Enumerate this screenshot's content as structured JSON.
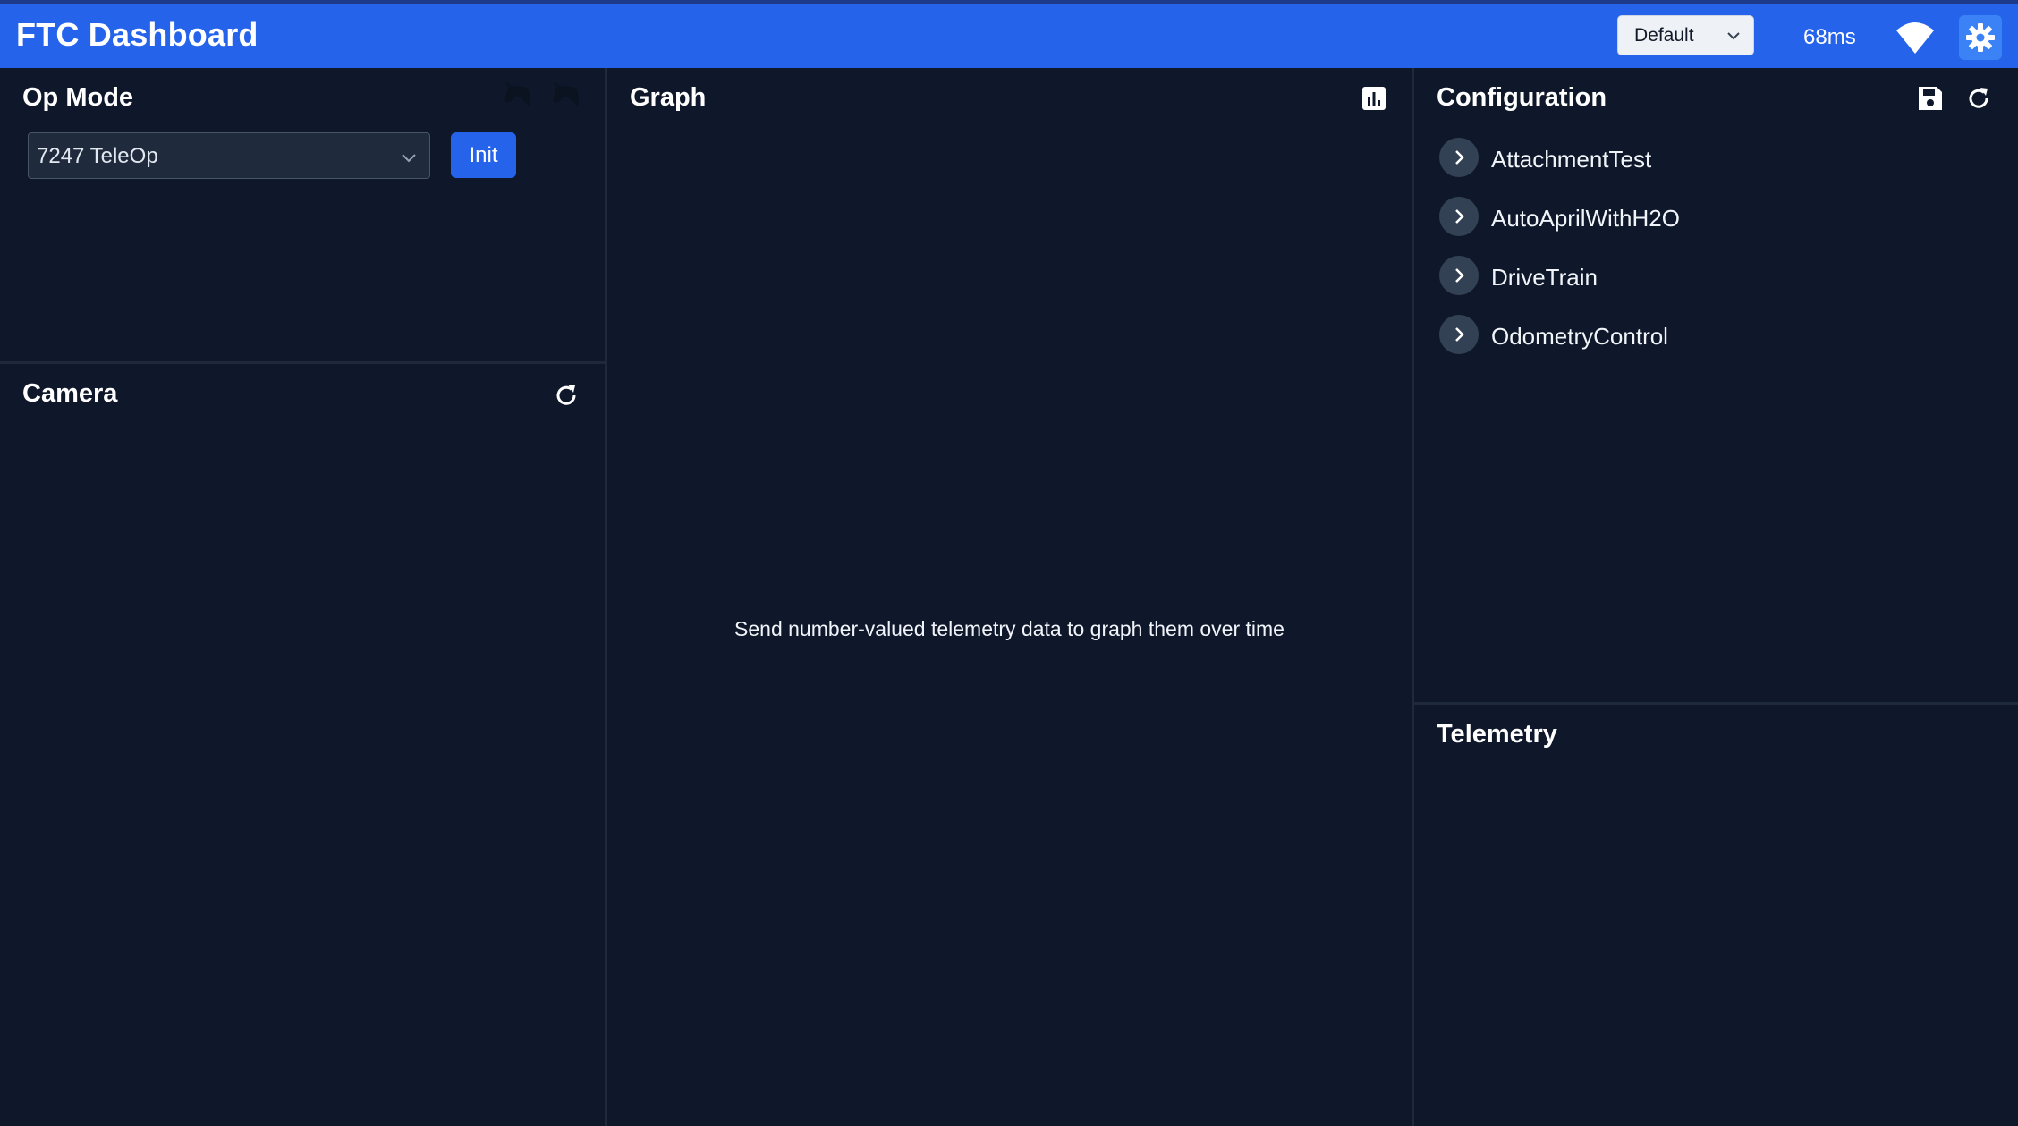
{
  "header": {
    "title": "FTC Dashboard",
    "layout_selected": "Default",
    "latency": "68ms",
    "icons": {
      "connection": "wifi-icon",
      "settings": "gear-icon"
    },
    "colors": {
      "bar": "#2563eb",
      "background": "#0f172a",
      "accent": "#2563eb"
    }
  },
  "opmode": {
    "title": "Op Mode",
    "selected": "7247 TeleOp",
    "init_label": "Init",
    "gamepad_icons": [
      "gamepad-disconnected-icon",
      "gamepad-disconnected-icon"
    ]
  },
  "camera": {
    "title": "Camera",
    "refresh_icon": "refresh-icon"
  },
  "graph": {
    "title": "Graph",
    "empty_message": "Send number-valued telemetry data to graph them over time",
    "icon": "bar-chart-icon"
  },
  "configuration": {
    "title": "Configuration",
    "items": [
      {
        "label": "AttachmentTest"
      },
      {
        "label": "AutoAprilWithH2O"
      },
      {
        "label": "DriveTrain"
      },
      {
        "label": "OdometryControl"
      }
    ],
    "icons": {
      "save": "save-icon",
      "refresh": "refresh-icon"
    }
  },
  "telemetry": {
    "title": "Telemetry"
  }
}
